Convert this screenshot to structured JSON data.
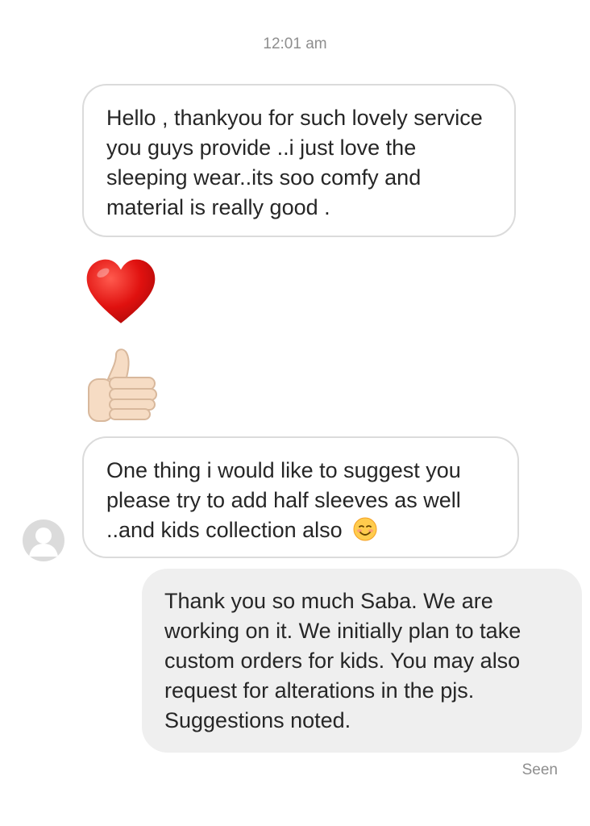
{
  "chat": {
    "timestamp": "12:01 am",
    "messages": [
      {
        "text": "Hello , thankyou for such lovely service you guys provide ..i just love the sleeping wear..its soo comfy and material is really good ."
      },
      {
        "emoji": "red-heart"
      },
      {
        "emoji": "thumbs-up"
      },
      {
        "text": "One thing i would like to suggest you please try to add half sleeves as well ..and kids collection also",
        "trailing_emoji": "smiling-face"
      },
      {
        "text": "Thank you so much Saba. We are working on it. We initially plan to take custom orders for kids. You may also request for alterations in the pjs. Suggestions noted."
      }
    ],
    "status": "Seen"
  },
  "colors": {
    "incoming_bubble_border": "#dbdbdb",
    "outgoing_bubble_bg": "#efefef",
    "meta_text": "#8e8e8e"
  }
}
